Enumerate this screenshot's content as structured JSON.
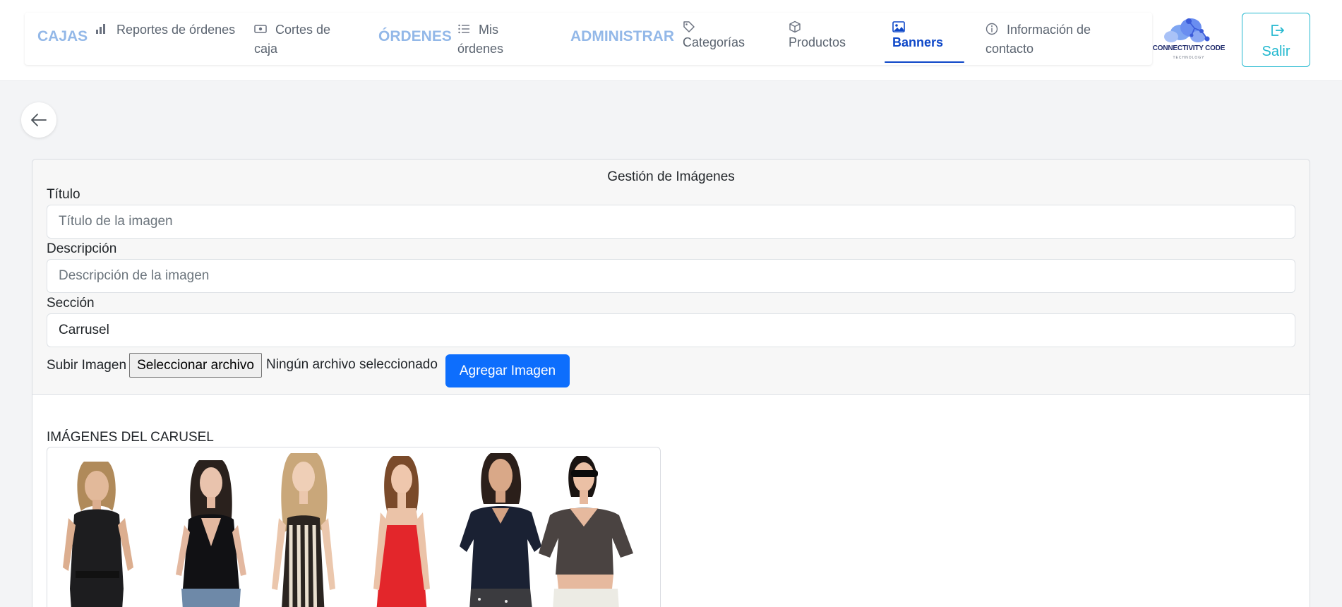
{
  "nav": {
    "groups": {
      "cajas": "CAJAS",
      "ordenes": "ÓRDENES",
      "administrar": "ADMINISTRAR"
    },
    "items": {
      "reportes": "Reportes de órdenes",
      "cortes": "Cortes de caja",
      "mis_ordenes": "Mis órdenes",
      "categorias": "Categorías",
      "productos": "Productos",
      "banners": "Banners",
      "informacion": "Información de contacto"
    },
    "active_item": "Banners",
    "logo_text": "CONNECTIVITY CODE",
    "logo_subtext": "TECHNOLOGY",
    "logout_label": "Salir"
  },
  "form": {
    "title": "Gestión de Imágenes",
    "titulo_label": "Título",
    "titulo_placeholder": "Título de la imagen",
    "descripcion_label": "Descripción",
    "descripcion_placeholder": "Descripción de la imagen",
    "seccion_label": "Sección",
    "seccion_value": "Carrusel",
    "upload_label": "Subir Imagen",
    "file_button": "Seleccionar archivo",
    "file_status": "Ningún archivo seleccionado",
    "add_button": "Agregar Imagen"
  },
  "gallery": {
    "heading": "IMÁGENES DEL CARUSEL",
    "images": [
      {
        "name": "black-sleeveless-jumpsuit"
      },
      {
        "name": "black-peplum-top"
      },
      {
        "name": "striped-slip-dress"
      },
      {
        "name": "red-slip-dress"
      },
      {
        "name": "navy-v-neck-tee"
      },
      {
        "name": "brown-wrap-crop-top"
      }
    ]
  },
  "colors": {
    "accent": "#0d6efd",
    "nav_active": "#0d47c8",
    "group_label": "#93b8e8",
    "logout": "#22b8cf"
  }
}
